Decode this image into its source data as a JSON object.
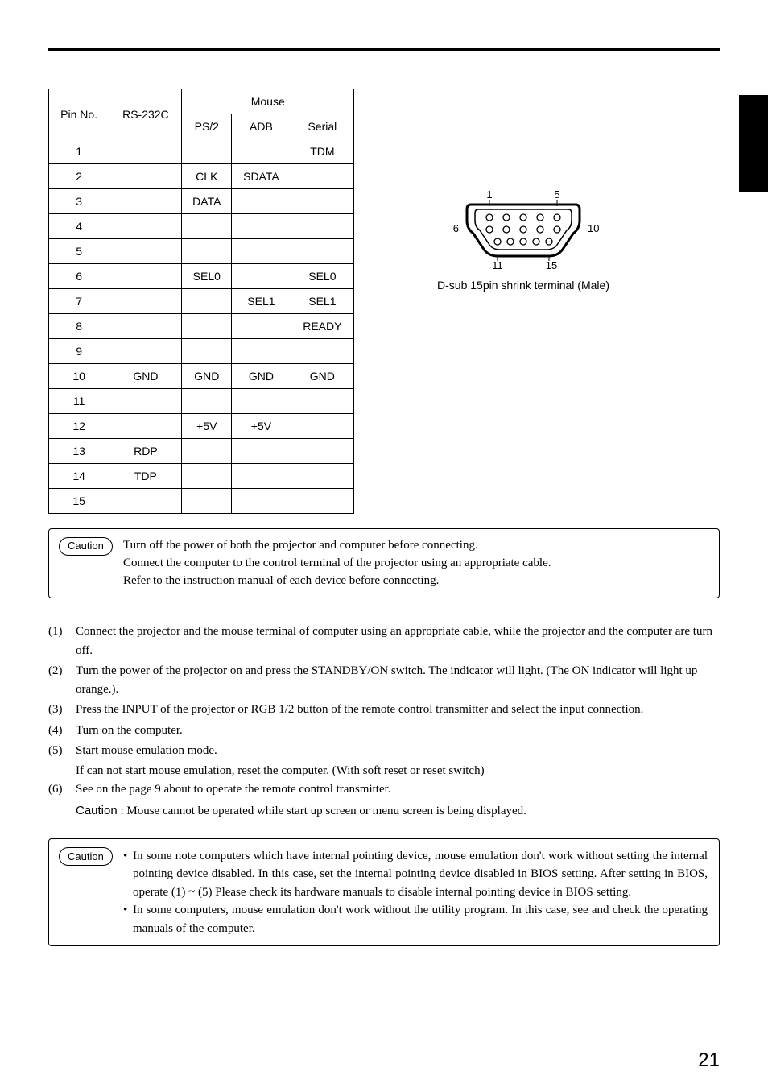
{
  "table": {
    "header": {
      "pin": "Pin No.",
      "rs232c": "RS-232C",
      "mouse": "Mouse",
      "ps2": "PS/2",
      "adb": "ADB",
      "serial": "Serial"
    },
    "rows": [
      {
        "pin": "1",
        "rs232c": "",
        "ps2": "",
        "adb": "",
        "serial": "TDM"
      },
      {
        "pin": "2",
        "rs232c": "",
        "ps2": "CLK",
        "adb": "SDATA",
        "serial": ""
      },
      {
        "pin": "3",
        "rs232c": "",
        "ps2": "DATA",
        "adb": "",
        "serial": ""
      },
      {
        "pin": "4",
        "rs232c": "",
        "ps2": "",
        "adb": "",
        "serial": ""
      },
      {
        "pin": "5",
        "rs232c": "",
        "ps2": "",
        "adb": "",
        "serial": ""
      },
      {
        "pin": "6",
        "rs232c": "",
        "ps2": "SEL0",
        "adb": "",
        "serial": "SEL0"
      },
      {
        "pin": "7",
        "rs232c": "",
        "ps2": "",
        "adb": "SEL1",
        "serial": "SEL1"
      },
      {
        "pin": "8",
        "rs232c": "",
        "ps2": "",
        "adb": "",
        "serial": "READY"
      },
      {
        "pin": "9",
        "rs232c": "",
        "ps2": "",
        "adb": "",
        "serial": ""
      },
      {
        "pin": "10",
        "rs232c": "GND",
        "ps2": "GND",
        "adb": "GND",
        "serial": "GND"
      },
      {
        "pin": "11",
        "rs232c": "",
        "ps2": "",
        "adb": "",
        "serial": ""
      },
      {
        "pin": "12",
        "rs232c": "",
        "ps2": "+5V",
        "adb": "+5V",
        "serial": ""
      },
      {
        "pin": "13",
        "rs232c": "RDP",
        "ps2": "",
        "adb": "",
        "serial": ""
      },
      {
        "pin": "14",
        "rs232c": "TDP",
        "ps2": "",
        "adb": "",
        "serial": ""
      },
      {
        "pin": "15",
        "rs232c": "",
        "ps2": "",
        "adb": "",
        "serial": ""
      }
    ]
  },
  "connector": {
    "labels": {
      "tl": "1",
      "tr": "5",
      "ml": "6",
      "mr": "10",
      "bl": "11",
      "br": "15"
    },
    "caption": "D-sub 15pin shrink terminal (Male)"
  },
  "caution1": {
    "label": "Caution",
    "line1": "Turn off the power of both the projector and computer before connecting.",
    "line2": "Connect the computer to the control terminal of the projector using an appropriate cable.",
    "line3": "Refer to the instruction manual of each device before connecting."
  },
  "procedure": {
    "items": [
      {
        "num": "(1)",
        "text": "Connect the projector and the mouse terminal of computer using an appropriate cable, while the projector and the computer are turn off."
      },
      {
        "num": "(2)",
        "text": "Turn the power of the projector on and press the STANDBY/ON switch. The indicator will light. (The ON indicator will light up orange.)."
      },
      {
        "num": "(3)",
        "text": "Press the INPUT of the projector or RGB 1/2 button of the remote control transmitter and select the input connection."
      },
      {
        "num": "(4)",
        "text": "Turn on the computer."
      },
      {
        "num": "(5)",
        "text": "Start mouse emulation mode."
      },
      {
        "num": "",
        "text": "If can not start mouse emulation, reset the computer. (With soft reset or reset switch)",
        "indent": true
      },
      {
        "num": "(6)",
        "text": "See on the page 9 about to operate the remote control transmitter."
      }
    ],
    "caution_label": "Caution",
    "caution_note": ": Mouse cannot be operated while start up screen or menu screen is being displayed."
  },
  "caution2": {
    "label": "Caution",
    "bullets": [
      "In some note computers which have internal pointing device, mouse emulation don't work without setting the internal pointing device disabled. In this case, set the internal pointing device disabled in BIOS setting. After setting in BIOS, operate (1) ~ (5) Please check its hardware manuals to disable internal pointing device in BIOS setting.",
      "In some computers, mouse emulation don't work without the utility program. In this case, see and check the operating manuals of the computer."
    ]
  },
  "page_number": "21"
}
